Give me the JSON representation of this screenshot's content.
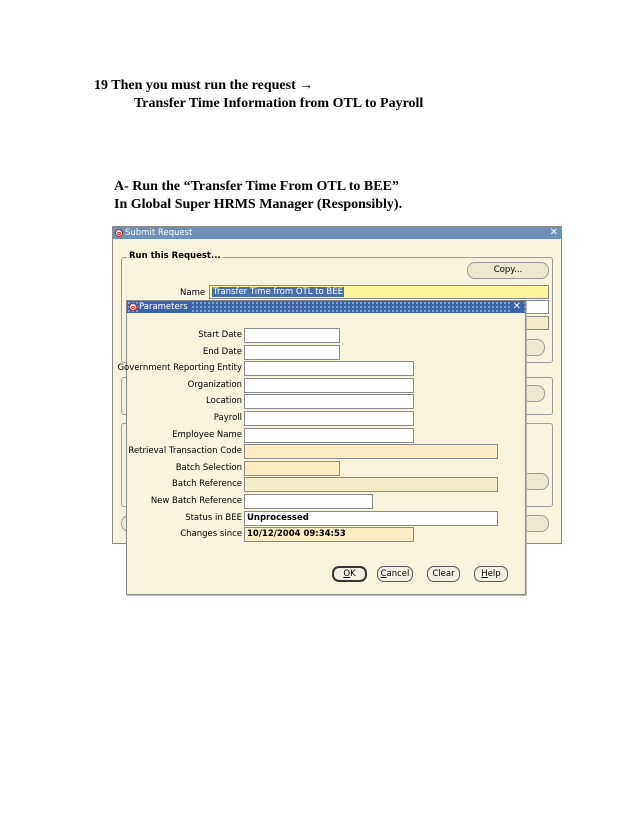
{
  "doc": {
    "step_line": "19 Then you must run the request",
    "step_arrow": "→",
    "step_sub": "Transfer Time Information from OTL to Payroll",
    "section_line1": "A- Run the “Transfer Time From OTL to BEE”",
    "section_line2": "In Global Super HRMS Manager (Responsibly)."
  },
  "submit_window": {
    "title": "Submit Request",
    "close_glyph": "✕",
    "group_label": "Run this Request...",
    "copy_button": "Copy...",
    "name_label": "Name",
    "name_value": "Transfer Time from OTL to BEE"
  },
  "parameters_window": {
    "title": "Parameters",
    "close_glyph": "✕",
    "fields": [
      {
        "label": "Start Date",
        "value": ""
      },
      {
        "label": "End Date",
        "value": ""
      },
      {
        "label": "Government Reporting Entity",
        "value": ""
      },
      {
        "label": "Organization",
        "value": ""
      },
      {
        "label": "Location",
        "value": ""
      },
      {
        "label": "Payroll",
        "value": ""
      },
      {
        "label": "Employee Name",
        "value": ""
      },
      {
        "label": "Retrieval Transaction Code",
        "value": ""
      },
      {
        "label": "Batch Selection",
        "value": ""
      },
      {
        "label": "Batch Reference",
        "value": ""
      },
      {
        "label": "New Batch Reference",
        "value": ""
      },
      {
        "label": "Status in BEE",
        "value": "Unprocessed"
      },
      {
        "label": "Changes since",
        "value": "10/12/2004 09:34:53"
      }
    ],
    "buttons": {
      "ok_first": "O",
      "ok_rest": "K",
      "cancel_first": "C",
      "cancel_rest": "ancel",
      "clear": "Clear",
      "help_first": "H",
      "help_rest": "elp"
    }
  }
}
